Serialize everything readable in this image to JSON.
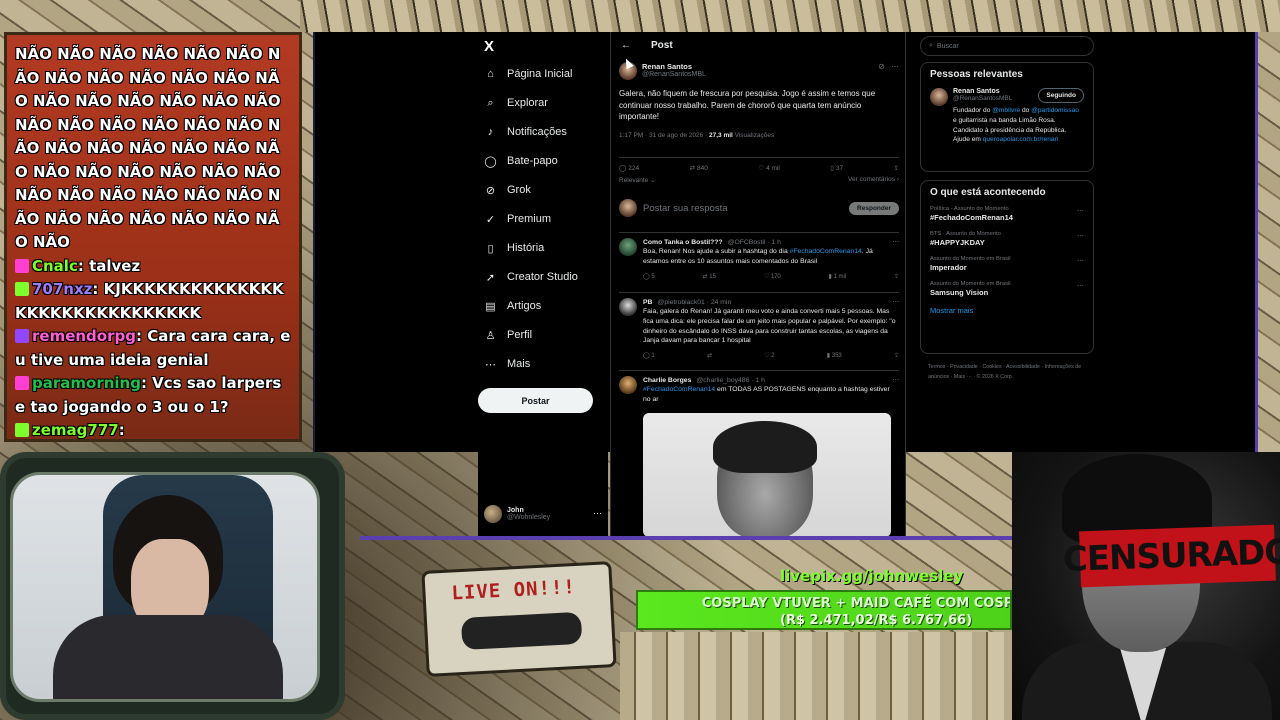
{
  "chat": {
    "lines": [
      {
        "user": "",
        "text": "NÃO NÃO NÃO NÃO NÃO NÃO NÃO NÃO NÃO NÃO NÃO NÃO NÃO NÃO NÃO NÃO NÃO NÃO NÃO NÃO NÃO NÃO NÃO NÃO NÃO NÃO NÃO NÃO NÃO NÃO NÃO NÃO NÃO NÃO NÃO NÃO NÃO NÃO NÃO NÃO NÃO NÃO NÃO NÃO NÃO NÃO NÃO NÃO NÃO NÃO NÃO NÃO",
        "user_color": "#ffffff"
      },
      {
        "user": "Cnalc",
        "text": ": talvez",
        "user_color": "#7dff2e"
      },
      {
        "user": "707nxz",
        "text": ": KJKKKKKKKKKKKKKKKKKKKKKKKKKKKKKK",
        "user_color": "#9b7bff"
      },
      {
        "user": "remendorpg",
        "text": ": Cara cara cara, eu tive uma ideia genial",
        "user_color": "#ff5fd2"
      },
      {
        "user": "paramorning",
        "text": ": Vcs sao larpers e tao jogando o 3 ou o 1?",
        "user_color": "#1fbf4a"
      },
      {
        "user": "zemag777",
        "text": ":",
        "user_color": "#7dff2e"
      }
    ]
  },
  "x_nav": {
    "logo": "X",
    "items": [
      {
        "icon": "home-icon",
        "glyph": "⌂",
        "label": "Página Inicial"
      },
      {
        "icon": "search-icon",
        "glyph": "⌕",
        "label": "Explorar"
      },
      {
        "icon": "bell-icon",
        "glyph": "♪",
        "label": "Notificações"
      },
      {
        "icon": "chat-icon",
        "glyph": "◯",
        "label": "Bate-papo"
      },
      {
        "icon": "grok-icon",
        "glyph": "⊘",
        "label": "Grok"
      },
      {
        "icon": "premium-icon",
        "glyph": "✓",
        "label": "Premium"
      },
      {
        "icon": "bookmark-icon",
        "glyph": "▯",
        "label": "História"
      },
      {
        "icon": "bolt-icon",
        "glyph": "➚",
        "label": "Creator Studio"
      },
      {
        "icon": "article-icon",
        "glyph": "▤",
        "label": "Artigos"
      },
      {
        "icon": "profile-icon",
        "glyph": "♙",
        "label": "Perfil"
      },
      {
        "icon": "more-icon",
        "glyph": "⋯",
        "label": "Mais"
      }
    ],
    "post_button": "Postar",
    "account": {
      "name": "John",
      "handle": "@Wohnlesley"
    }
  },
  "post": {
    "header_title": "Post",
    "author": "Renan Santos",
    "handle": "@RenanSantosMBL",
    "text": "Galera, não fiquem de frescura por pesquisa. Jogo é assim e temos que continuar nosso trabalho. Parem de chororô que quarta tem anúncio importante!",
    "meta_time": "1:17 PM · 31 de ago de 2026 · ",
    "meta_views": "27,3 mil",
    "meta_views_label": " Visualizações",
    "stats": {
      "replies": "224",
      "reposts": "840",
      "likes": "4 mil",
      "bookmarks": "37"
    },
    "sort_label": "Relevante",
    "see_comments": "Ver comentários",
    "reply_placeholder": "Postar sua resposta",
    "reply_button": "Responder"
  },
  "replies": [
    {
      "name": "Como Tanka o Bostil???",
      "handle": "@OFCBostil · 1 h",
      "text_before": "Boa, Renan! Nos ajude a subir a hashtag do dia ",
      "link": "#FechadoComRenan14",
      "text_after": ". Já estamos entre os 10 assuntos mais comentados do Brasil",
      "stats": {
        "replies": "5",
        "reposts": "15",
        "likes": "170",
        "views": "1 mil"
      }
    },
    {
      "name": "PB",
      "handle": "@pietroblack01 · 24 min",
      "text_before": "Faia, galera do Renan! Já garanti meu voto e ainda converti mais 5 pessoas. Mas fica uma dica: ele precisa falar de um jeito mais popular e palpável. Por exemplo: \"o dinheiro do escândalo do INSS dava para construir tantas escolas, as viagens da Janja davam para bancar 1 hospital",
      "link": "",
      "text_after": "",
      "stats": {
        "replies": "1",
        "reposts": "",
        "likes": "2",
        "views": "353"
      }
    },
    {
      "name": "Charlie Borges",
      "handle": "@charlie_boy486 · 1 h",
      "text_before": "",
      "link": "#FechadoComRenan14",
      "text_after": " em TODAS AS POSTAGENS enquanto a hashtag estiver no ar",
      "stats": {
        "replies": "",
        "reposts": "",
        "likes": "",
        "views": ""
      }
    }
  ],
  "right_col": {
    "search_placeholder": "Buscar",
    "relevant_title": "Pessoas relevantes",
    "relevant_person": {
      "name": "Renan Santos",
      "handle": "@RenanSantosMBL",
      "follow_label": "Seguindo",
      "bio_1": "Fundador do ",
      "bio_link_1": "@mblivre",
      "bio_2": " do ",
      "bio_link_2": "@partidomissao",
      "bio_3": " e guitarrista na banda Limão Rosa. Candidato à presidência da República. Ajude em ",
      "bio_link_3": "queroapoiar.com.br/renan"
    },
    "trends_title": "O que está acontecendo",
    "trends": [
      {
        "context": "Política · Assunto do Momento",
        "name": "#FechadoComRenan14"
      },
      {
        "context": "BTS · Assunto do Momento",
        "name": "#HAPPYJKDAY"
      },
      {
        "context": "Assunto do Momento em Brasil",
        "name": "Imperador"
      },
      {
        "context": "Assunto do Momento em Brasil",
        "name": "Samsung Vision"
      }
    ],
    "show_more": "Mostrar mais",
    "footer": "Termos · Privacidade · Cookies · Acessibilidade · Informações de anúncios · Mais ··· · © 2026 X Corp."
  },
  "overlay": {
    "cassette_label": "LIVE ON!!!",
    "livepix": "livepix.gg/johnwesley",
    "goal_title": "COSPLAY VTUVER + MAID CAFÉ COM COSPLAY (",
    "goal_amount": "(R$ 2.471,02/R$ 6.767,66)",
    "goal_progress": 0.365,
    "censor_label": "CENSURADO"
  },
  "colors": {
    "x_blue": "#1d9bf0",
    "chat_bg": "#b33a22",
    "goal_green": "#5ae81e",
    "censor_red": "#c01218"
  }
}
